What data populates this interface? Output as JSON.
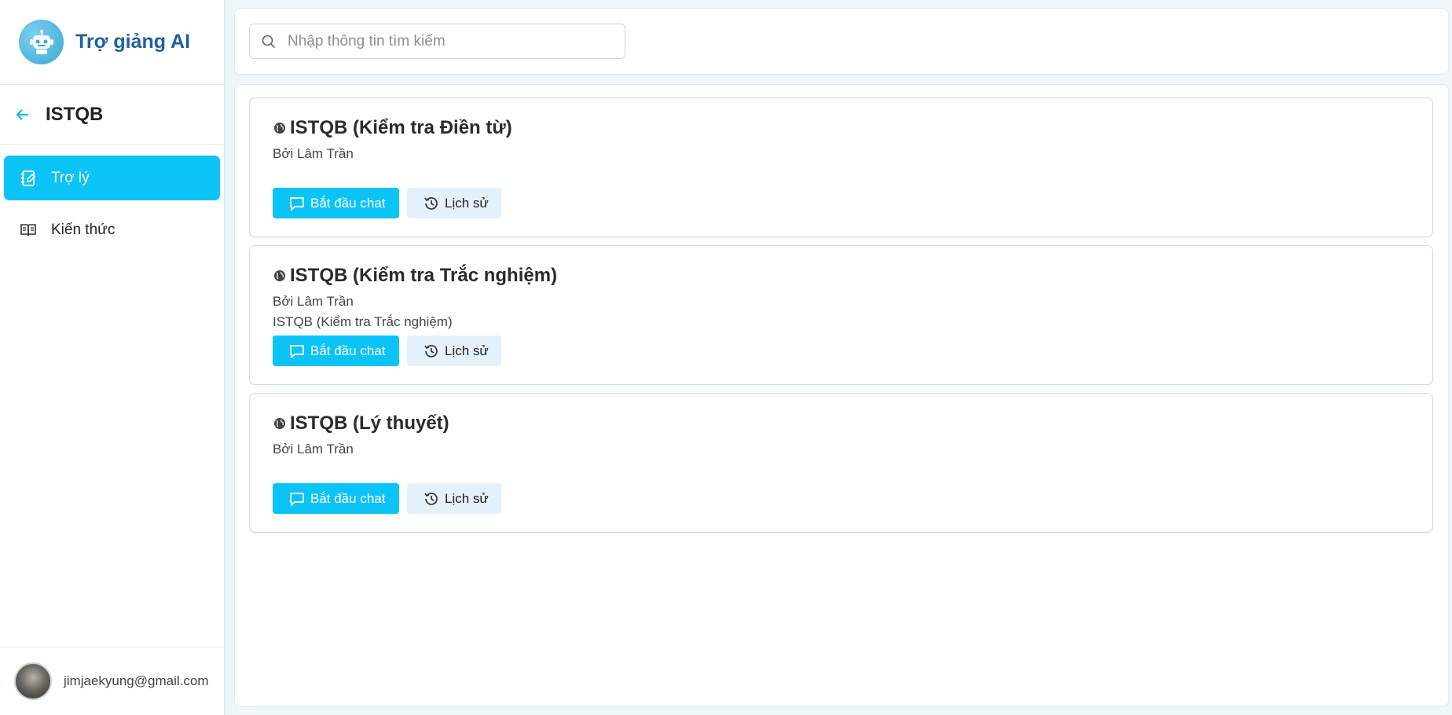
{
  "brand": {
    "title": "Trợ giảng AI",
    "logo_icon": "robot-icon"
  },
  "project": {
    "name": "ISTQB",
    "back_icon": "arrow-left-icon"
  },
  "nav": {
    "items": [
      {
        "label": "Trợ lý",
        "icon": "notebook-pen-icon",
        "active": true
      },
      {
        "label": "Kiến thức",
        "icon": "book-open-icon",
        "active": false
      }
    ]
  },
  "user": {
    "email": "jimjaekyung@gmail.com"
  },
  "search": {
    "placeholder": "Nhập thông tin tìm kiếm",
    "value": ""
  },
  "cards": [
    {
      "title": "ISTQB (Kiểm tra Điền từ)",
      "author": "Bởi Lâm Trần",
      "description": "",
      "start_label": "Bắt đầu chat",
      "history_label": "Lịch sử"
    },
    {
      "title": "ISTQB (Kiểm tra Trắc nghiệm)",
      "author": "Bởi Lâm Trần",
      "description": "ISTQB (Kiểm tra Trắc nghiệm)",
      "start_label": "Bắt đầu chat",
      "history_label": "Lịch sử"
    },
    {
      "title": "ISTQB (Lý thuyết)",
      "author": "Bởi Lâm Trần",
      "description": "",
      "start_label": "Bắt đầu chat",
      "history_label": "Lịch sử"
    }
  ],
  "colors": {
    "accent": "#0cc3f7",
    "brand": "#1f5fa5",
    "secondary_button": "#e4f1fb",
    "background": "#eef6fa"
  }
}
